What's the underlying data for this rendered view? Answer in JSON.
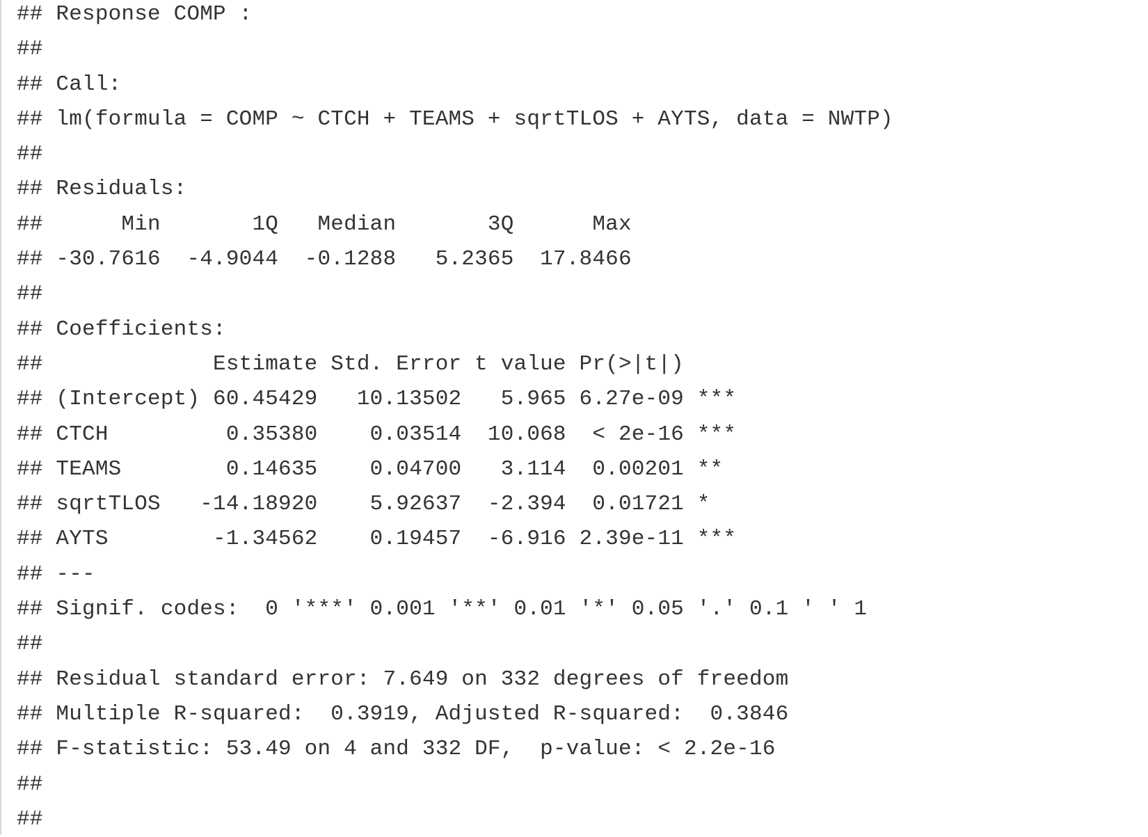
{
  "console": {
    "lines": [
      "## Response COMP :",
      "##",
      "## Call:",
      "## lm(formula = COMP ~ CTCH + TEAMS + sqrtTLOS + AYTS, data = NWTP)",
      "##",
      "## Residuals:",
      "##      Min       1Q   Median       3Q      Max",
      "## -30.7616  -4.9044  -0.1288   5.2365  17.8466",
      "##",
      "## Coefficients:",
      "##             Estimate Std. Error t value Pr(>|t|)",
      "## (Intercept) 60.45429   10.13502   5.965 6.27e-09 ***",
      "## CTCH         0.35380    0.03514  10.068  < 2e-16 ***",
      "## TEAMS        0.14635    0.04700   3.114  0.00201 **",
      "## sqrtTLOS   -14.18920    5.92637  -2.394  0.01721 *",
      "## AYTS        -1.34562    0.19457  -6.916 2.39e-11 ***",
      "## ---",
      "## Signif. codes:  0 '***' 0.001 '**' 0.01 '*' 0.05 '.' 0.1 ' ' 1",
      "##",
      "## Residual standard error: 7.649 on 332 degrees of freedom",
      "## Multiple R-squared:  0.3919, Adjusted R-squared:  0.3846",
      "## F-statistic: 53.49 on 4 and 332 DF,  p-value: < 2.2e-16",
      "##",
      "##"
    ]
  }
}
